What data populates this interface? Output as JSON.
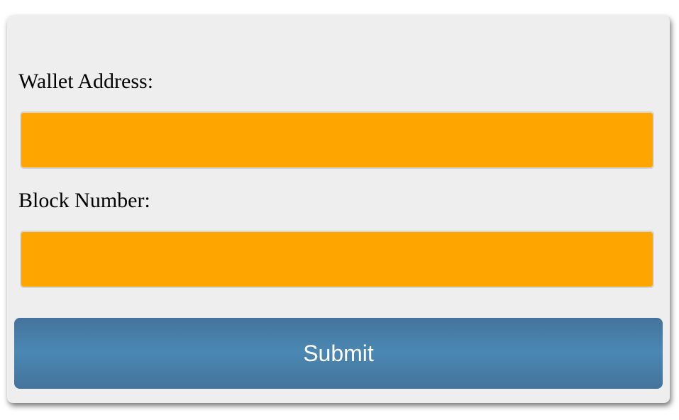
{
  "form": {
    "wallet_label": "Wallet Address:",
    "wallet_value": "",
    "wallet_placeholder": "",
    "block_label": "Block Number:",
    "block_value": "",
    "block_placeholder": "",
    "submit_label": "Submit"
  },
  "colors": {
    "card_background": "#eeeeee",
    "input_background": "#ffa500",
    "button_background": "#4a88b3",
    "button_text": "#ffffff"
  }
}
